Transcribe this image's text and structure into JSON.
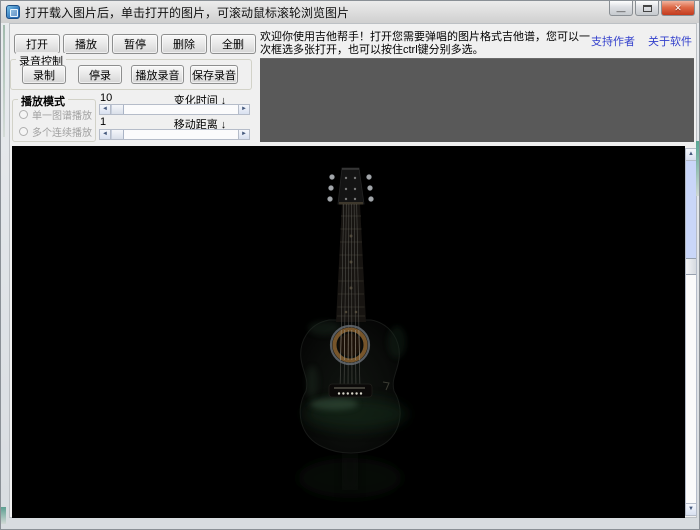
{
  "window": {
    "title": "打开载入图片后，单击打开的图片，可滚动鼠标滚轮浏览图片"
  },
  "icons": {
    "minimize": "—",
    "close": "✕",
    "scroll_up": "▲",
    "scroll_down": "▼",
    "scroll_left": "◄",
    "scroll_right": "►",
    "down_arrow": "↓"
  },
  "toolbar": {
    "buttons": [
      "打开",
      "播放",
      "暂停",
      "删除",
      "全删"
    ]
  },
  "recording": {
    "group_label": "录音控制",
    "buttons": [
      "录制",
      "停录",
      "播放录音",
      "保存录音"
    ]
  },
  "play_mode": {
    "group_label": "播放模式",
    "options": [
      "单一图谱播放",
      "多个连续播放"
    ]
  },
  "params": {
    "change_time": {
      "value": "10",
      "label": "变化时间"
    },
    "move_distance": {
      "value": "1",
      "label": "移动距离"
    }
  },
  "welcome_text": "欢迎你使用吉他帮手！打开您需要弹唱的图片格式吉他谱，您可以一次框选多张打开，也可以按住ctrl键分别多选。",
  "links": {
    "support_author": "支持作者",
    "about_software": "关于软件"
  },
  "viewer": {
    "content": "black-acoustic-guitar-photo"
  },
  "colors": {
    "link_blue": "#3340cc",
    "panel_gray": "#595959",
    "viewer_bg": "#000000",
    "scroll_track_blue": "#c9d6f8"
  }
}
